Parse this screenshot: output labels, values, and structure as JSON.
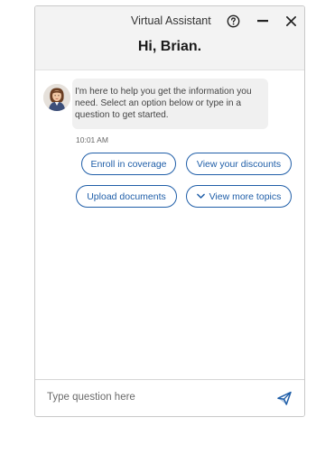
{
  "header": {
    "title": "Virtual Assistant",
    "greeting": "Hi, Brian.",
    "icons": [
      "help-icon",
      "minimize-icon",
      "close-icon"
    ]
  },
  "conversation": {
    "message": "I'm here to help you get the information you need. Select an option below or type in a question to get started.",
    "timestamp": "10:01 AM",
    "avatar_icon": "assistant-avatar"
  },
  "options": [
    {
      "label": "Enroll in coverage"
    },
    {
      "label": "View your discounts"
    },
    {
      "label": "Upload documents"
    },
    {
      "label": "View more topics",
      "icon": "chevron-down-icon"
    }
  ],
  "input": {
    "placeholder": "Type question here",
    "value": "",
    "send_icon": "send-icon"
  },
  "colors": {
    "accent": "#1f5ea8",
    "header_bg": "#f3f3f3",
    "bubble_bg": "#f0f0f0"
  }
}
